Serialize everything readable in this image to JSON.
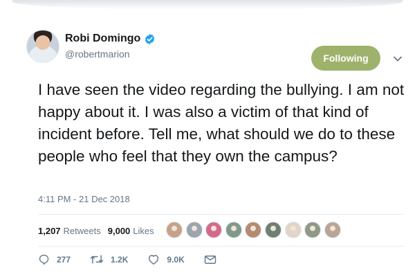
{
  "user": {
    "display_name": "Robi Domingo",
    "handle": "@robertmarion"
  },
  "follow_button": {
    "label": "Following"
  },
  "tweet": {
    "text": "I have seen the video regarding the bullying. I am not happy about it. I was also a victim of that kind of incident before. Tell me, what should we do to these people who feel that they own the campus?",
    "timestamp": "4:11 PM - 21 Dec 2018"
  },
  "stats": {
    "retweets_count": "1,207",
    "retweets_label": "Retweets",
    "likes_count": "9,000",
    "likes_label": "Likes"
  },
  "likers": [
    {
      "color": "#c7a28b"
    },
    {
      "color": "#9aa5ae"
    },
    {
      "color": "#d46a8a"
    },
    {
      "color": "#7f9a8c"
    },
    {
      "color": "#b58a72"
    },
    {
      "color": "#6e7f73"
    },
    {
      "color": "#e2d4c8"
    },
    {
      "color": "#8f9a86"
    },
    {
      "color": "#b9a596"
    }
  ],
  "actions": {
    "reply_count": "277",
    "retweet_count": "1.2K",
    "like_count": "9.0K"
  },
  "colors": {
    "follow_button": "#9fb26c",
    "verified_badge": "#1da1f2",
    "secondary_text": "#657786"
  },
  "icons": [
    "verified-icon",
    "chevron-down-icon",
    "reply-icon",
    "retweet-icon",
    "like-icon",
    "direct-message-icon"
  ]
}
